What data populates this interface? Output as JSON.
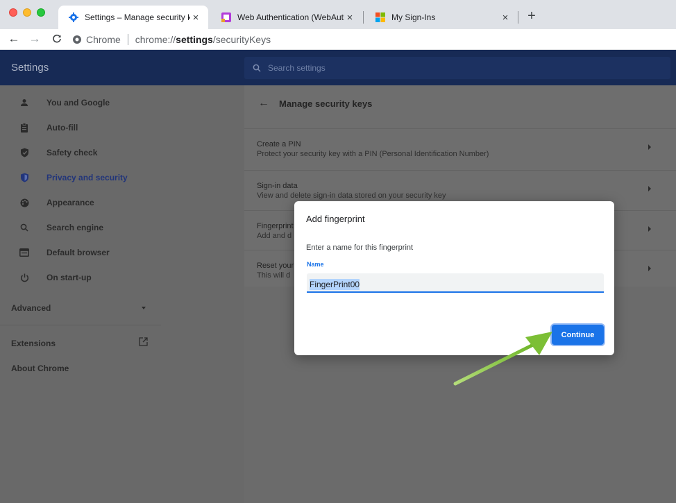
{
  "browser": {
    "tabs": [
      {
        "title": "Settings – Manage security key",
        "close": "×"
      },
      {
        "title": "Web Authentication (WebAuthn",
        "close": "×"
      },
      {
        "title": "My Sign-Ins",
        "close": "×"
      }
    ],
    "new_tab": "+",
    "address": {
      "origin_label": "Chrome",
      "url_prefix": "chrome://",
      "url_host": "settings",
      "url_path": "/securityKeys"
    }
  },
  "settings": {
    "header_title": "Settings",
    "search_placeholder": "Search settings",
    "sidebar": {
      "items": [
        {
          "label": "You and Google",
          "icon": "person-icon"
        },
        {
          "label": "Auto-fill",
          "icon": "clipboard-icon"
        },
        {
          "label": "Safety check",
          "icon": "shield-check-icon"
        },
        {
          "label": "Privacy and security",
          "icon": "shield-icon",
          "active": true
        },
        {
          "label": "Appearance",
          "icon": "palette-icon"
        },
        {
          "label": "Search engine",
          "icon": "search-icon"
        },
        {
          "label": "Default browser",
          "icon": "browser-icon"
        },
        {
          "label": "On start-up",
          "icon": "power-icon"
        }
      ],
      "advanced": "Advanced",
      "extensions": "Extensions",
      "about": "About Chrome"
    },
    "page_heading": "Manage security keys",
    "rows": [
      {
        "title": "Create a PIN",
        "subtitle": "Protect your security key with a PIN (Personal Identification Number)"
      },
      {
        "title": "Sign-in data",
        "subtitle": "View and delete sign-in data stored on your security key"
      },
      {
        "title": "Fingerprint",
        "subtitle": "Add and d"
      },
      {
        "title": "Reset your",
        "subtitle": "This will d"
      }
    ]
  },
  "dialog": {
    "title": "Add fingerprint",
    "description": "Enter a name for this fingerprint",
    "field_label": "Name",
    "field_value": "FingerPrint00",
    "continue_label": "Continue"
  },
  "colors": {
    "accent": "#1a73e8",
    "header_bg": "#172a55",
    "annotation_arrow": "#8dc63f"
  }
}
